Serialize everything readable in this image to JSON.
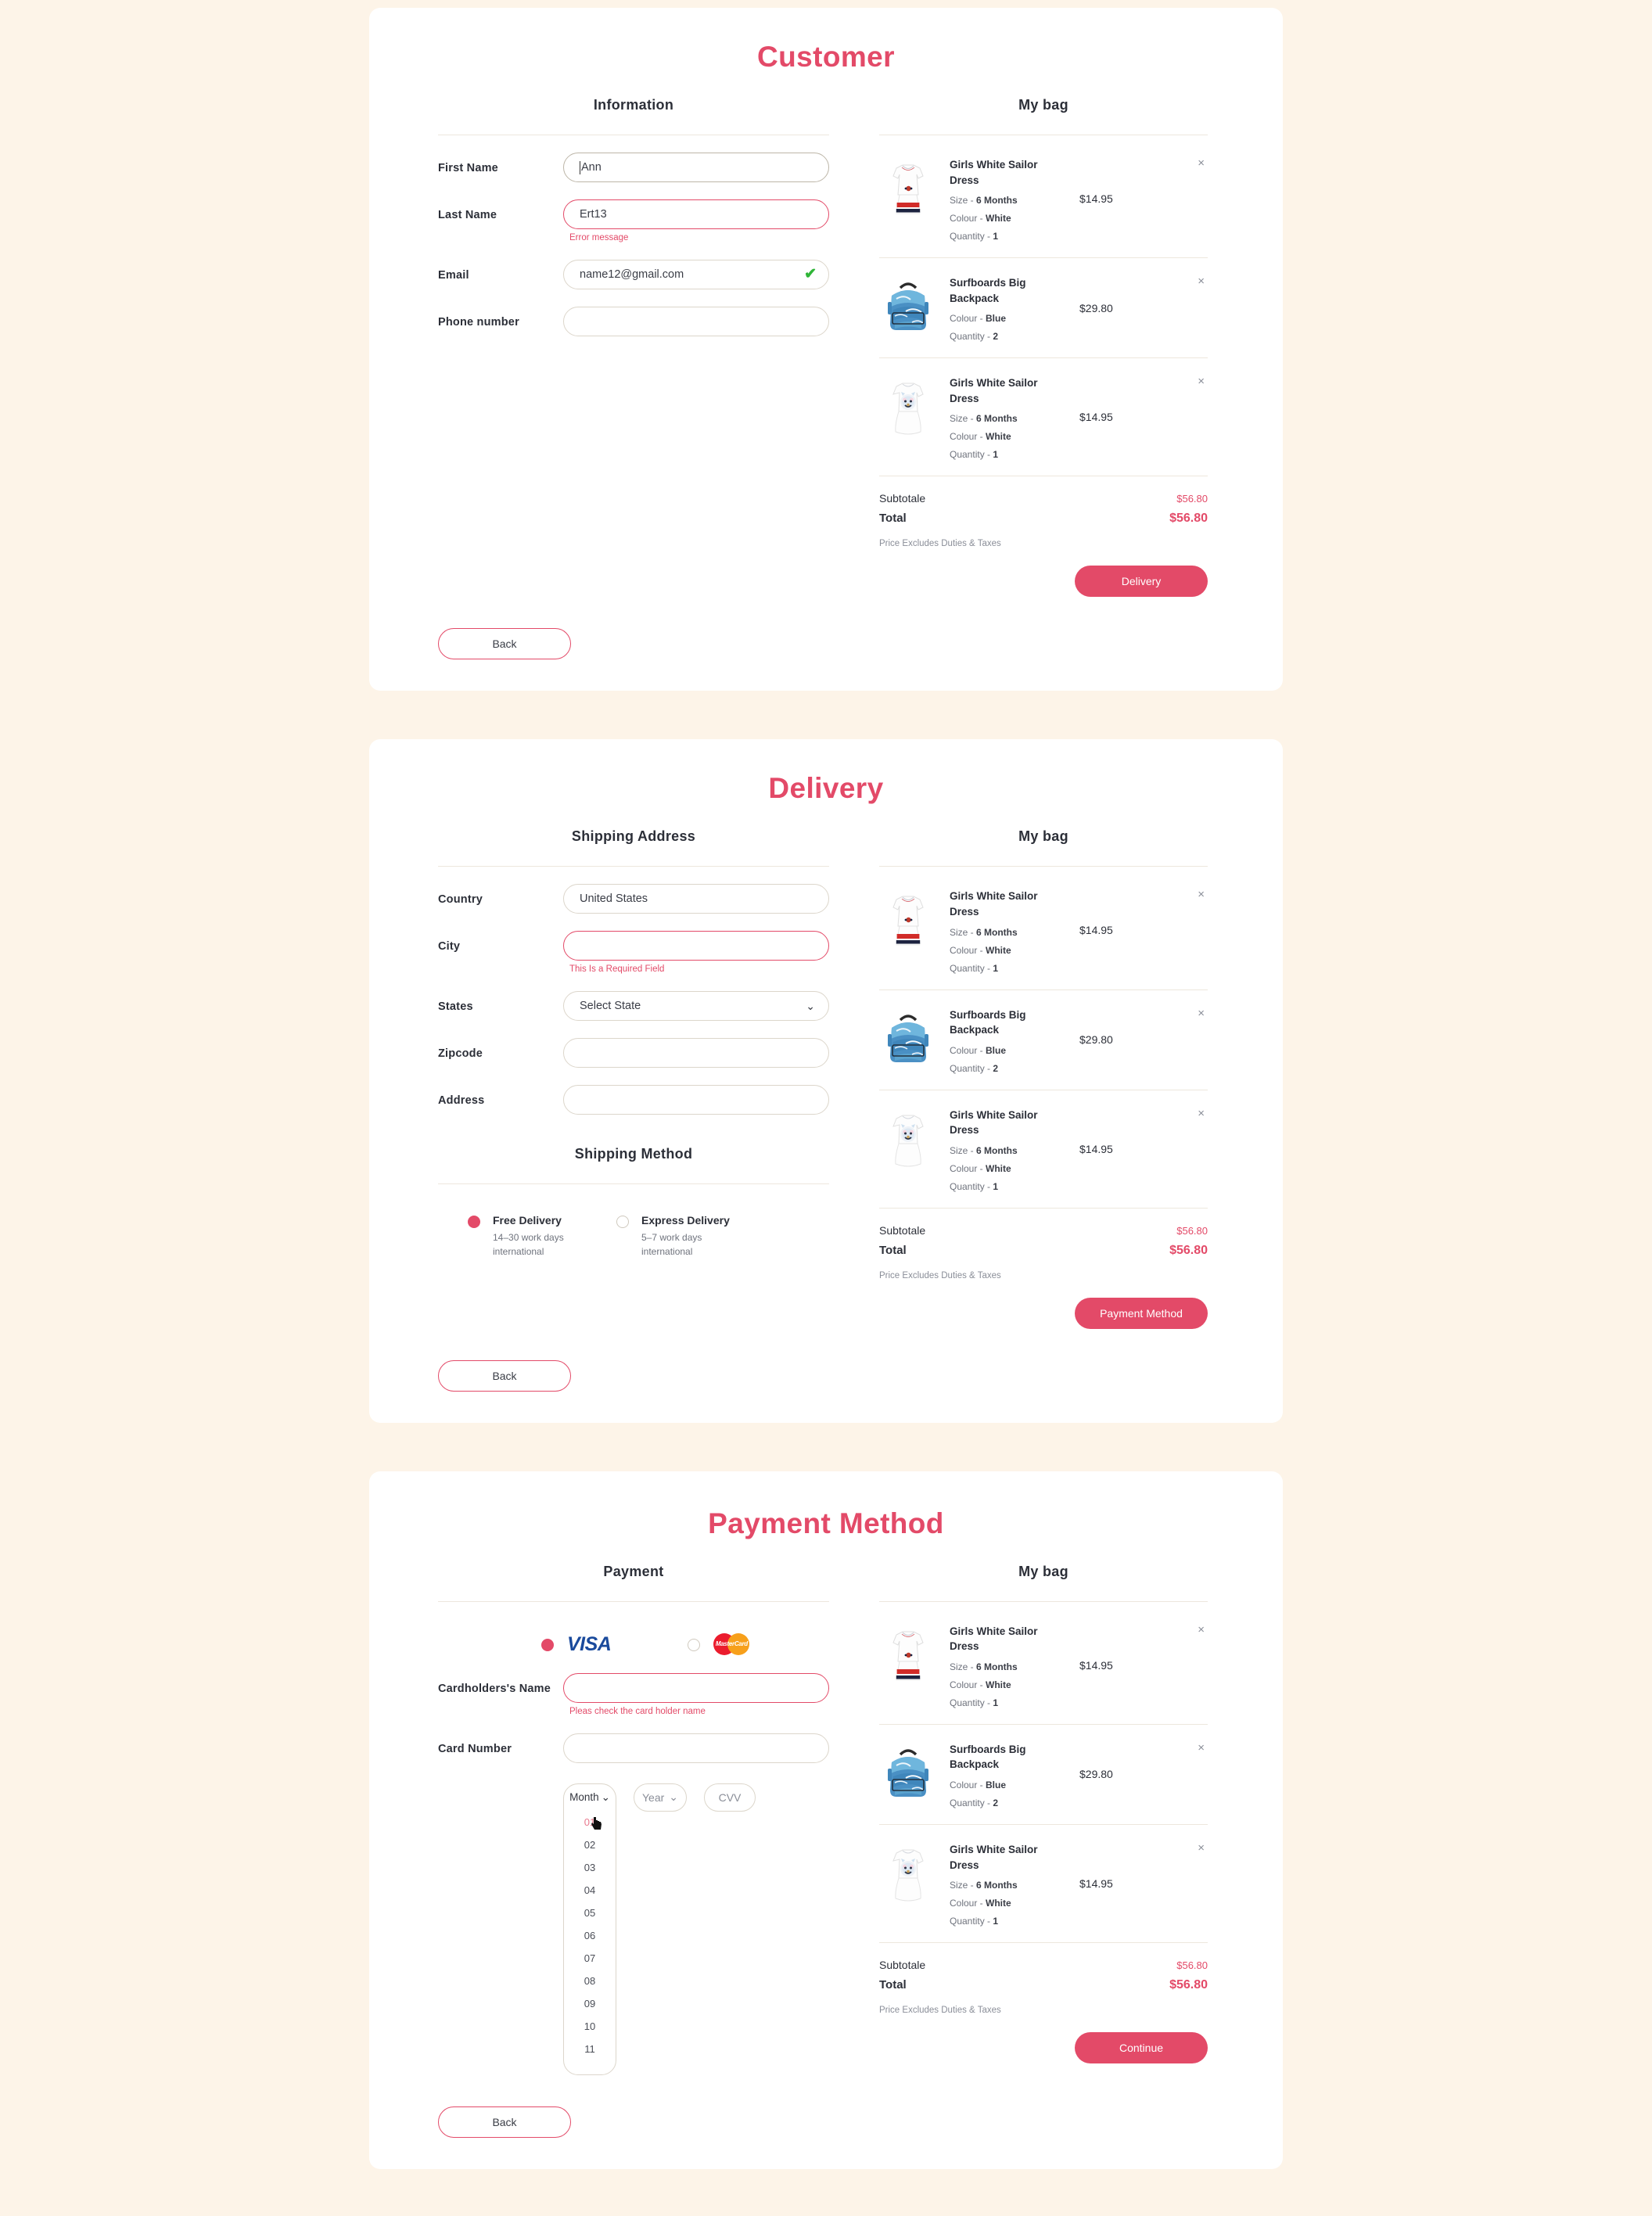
{
  "theme": {
    "accent": "#E34A68",
    "page_bg": "#FDF4E8",
    "card_bg": "#FFFFFF",
    "success": "#2FB537"
  },
  "sections": [
    {
      "id": "customer",
      "title": "Customer",
      "left_heading": "Information",
      "right_heading": "My bag",
      "fields": [
        {
          "label": "First Name",
          "value": "Ann",
          "placeholder": "",
          "state": "focused",
          "error": "",
          "check": false
        },
        {
          "label": "Last Name",
          "value": "Ert13",
          "placeholder": "",
          "state": "error",
          "error": "Error message",
          "check": false
        },
        {
          "label": "Email",
          "value": "name12@gmail.com",
          "placeholder": "",
          "state": "normal",
          "error": "",
          "check": true
        },
        {
          "label": "Phone number",
          "value": "",
          "placeholder": "",
          "state": "normal",
          "error": "",
          "check": false
        }
      ],
      "back_label": "Back",
      "primary_label": "Delivery"
    },
    {
      "id": "delivery",
      "title": "Delivery",
      "left_heading": "Shipping Address",
      "right_heading": "My bag",
      "fields": [
        {
          "label": "Country",
          "value": "United States",
          "state": "normal",
          "error": ""
        },
        {
          "label": "City",
          "value": "",
          "state": "error",
          "error": "This Is a Required Field"
        },
        {
          "label": "States",
          "value": "Select State",
          "state": "select",
          "error": ""
        },
        {
          "label": "Zipcode",
          "value": "",
          "state": "normal",
          "error": ""
        },
        {
          "label": "Address",
          "value": "",
          "state": "normal",
          "error": ""
        }
      ],
      "shipping_method_heading": "Shipping Method",
      "shipping_options": [
        {
          "name": "Free Delivery",
          "detail": "14–30 work days\ninternational",
          "selected": true
        },
        {
          "name": "Express Delivery",
          "detail": "5–7 work days\ninternational",
          "selected": false
        }
      ],
      "back_label": "Back",
      "primary_label": "Payment Method"
    },
    {
      "id": "payment",
      "title": "Payment Method",
      "left_heading": "Payment",
      "right_heading": "My bag",
      "card_brands": [
        {
          "name": "visa-logo",
          "label": "VISA",
          "selected": true
        },
        {
          "name": "mastercard-logo",
          "label": "MasterCard",
          "selected": false
        }
      ],
      "fields": [
        {
          "label": "Cardholders's Name",
          "value": "",
          "state": "error",
          "error": "Pleas check the card holder name"
        },
        {
          "label": "Card Number",
          "value": "",
          "state": "normal",
          "error": ""
        }
      ],
      "expiry": {
        "month_label": "Month",
        "month_open": true,
        "month_selected": "01",
        "month_options": [
          "01",
          "02",
          "03",
          "04",
          "05",
          "06",
          "07",
          "08",
          "09",
          "10",
          "11"
        ],
        "year_label": "Year",
        "cvv_label": "CVV"
      },
      "back_label": "Back",
      "primary_label": "Continue"
    }
  ],
  "bag": {
    "heading": "My bag",
    "items": [
      {
        "art": "sailor-dress",
        "name": "Girls White Sailor Dress",
        "attrs": [
          {
            "key": "Size - ",
            "val": "6 Months"
          },
          {
            "key": "Colour - ",
            "val": "White"
          },
          {
            "key": "Quantity - ",
            "val": "1"
          }
        ],
        "price": "$14.95"
      },
      {
        "art": "surf-backpack",
        "name": "Surfboards Big Backpack",
        "attrs": [
          {
            "key": "Colour - ",
            "val": "Blue"
          },
          {
            "key": "Quantity - ",
            "val": "2"
          }
        ],
        "price": "$29.80"
      },
      {
        "art": "tiger-dress",
        "name": "Girls White Sailor Dress",
        "attrs": [
          {
            "key": "Size - ",
            "val": "6 Months"
          },
          {
            "key": "Colour - ",
            "val": "White"
          },
          {
            "key": "Quantity - ",
            "val": "1"
          }
        ],
        "price": "$14.95"
      }
    ],
    "subtotal_label": "Subtotale",
    "subtotal_value": "$56.80",
    "total_label": "Total",
    "total_value": "$56.80",
    "note": "Price Excludes Duties & Taxes",
    "remove_icon": "×"
  }
}
